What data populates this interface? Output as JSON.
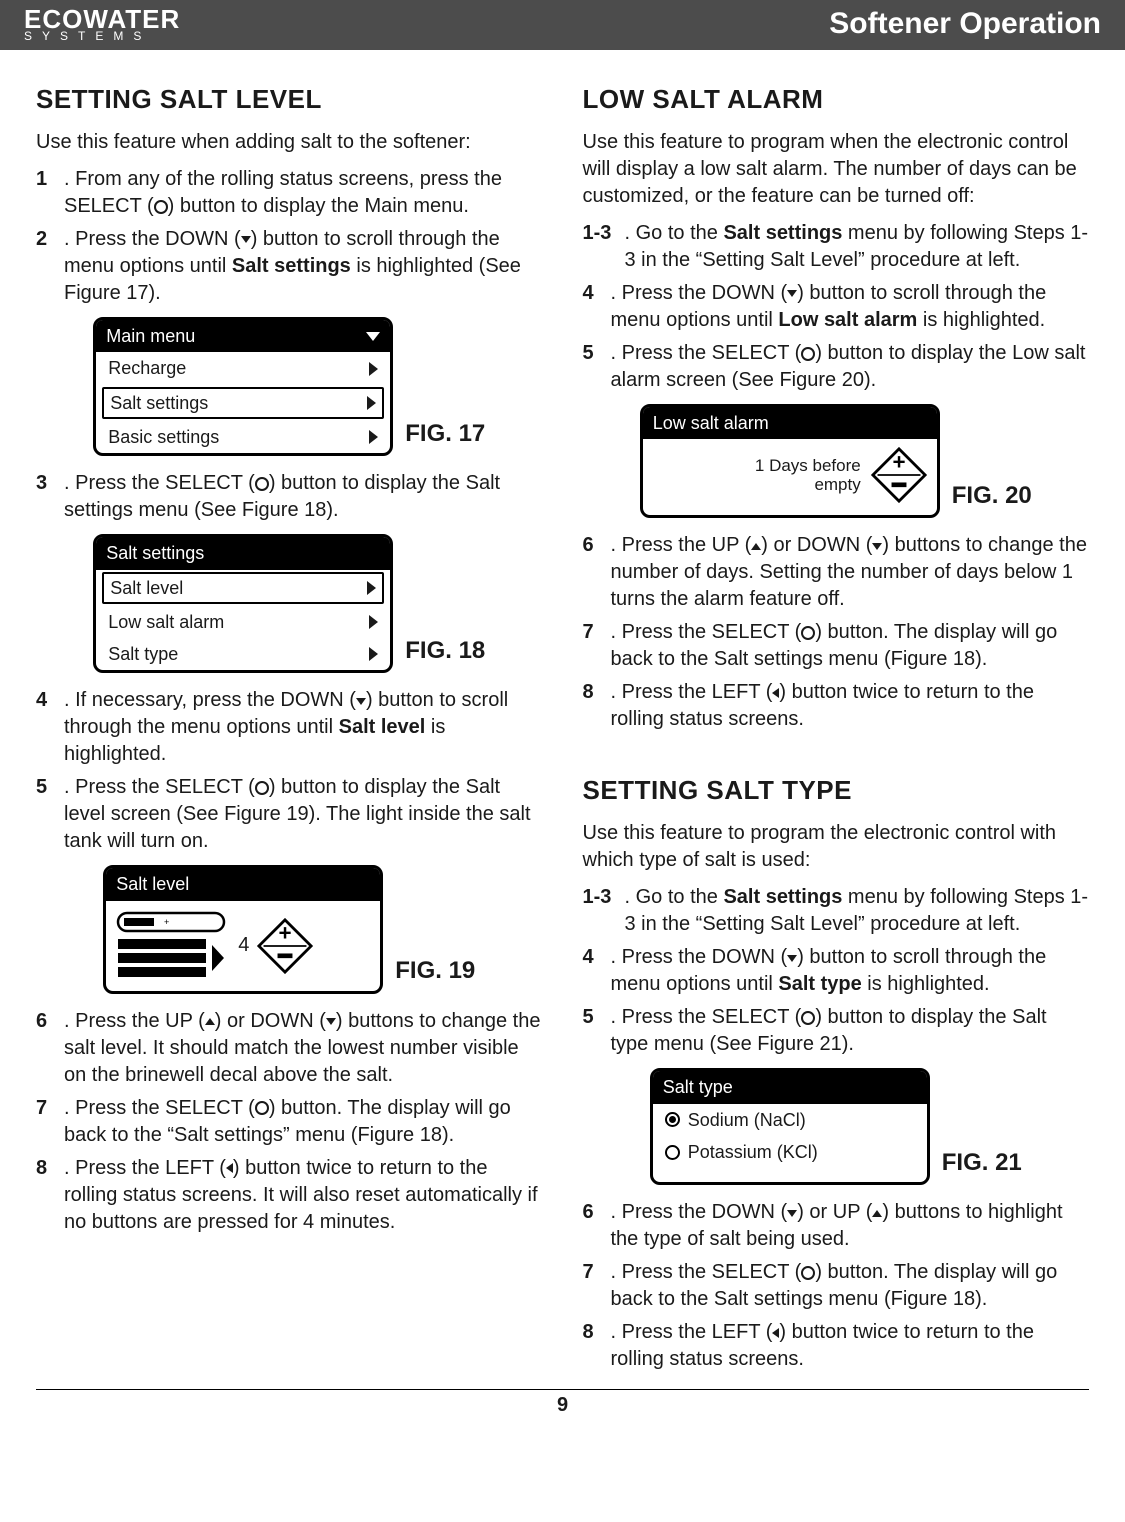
{
  "header": {
    "brand_top": "ECOWATER",
    "brand_bottom": "SYSTEMS",
    "title": "Softener Operation"
  },
  "page_number": "9",
  "left": {
    "h": "SETTING SALT LEVEL",
    "intro": "Use this feature when adding salt to the softener:",
    "s1n": "1",
    "s1a": ". From any of the rolling status screens, press the SELECT (",
    "s1b": ") button to display the Main menu.",
    "s2n": "2",
    "s2a": ". Press the DOWN (",
    "s2b": ") button to scroll through the menu options until ",
    "s2bold": "Salt settings",
    "s2c": " is highlighted (See Figure 17).",
    "fig17": {
      "title": "Main menu",
      "row1": "Recharge",
      "row2": "Salt settings",
      "row3": "Basic settings",
      "label": "FIG. 17"
    },
    "s3n": "3",
    "s3a": ". Press the SELECT (",
    "s3b": ") button to display the Salt settings menu (See Figure 18).",
    "fig18": {
      "title": "Salt settings",
      "row1": "Salt level",
      "row2": "Low salt alarm",
      "row3": "Salt type",
      "label": "FIG. 18"
    },
    "s4n": "4",
    "s4a": ". If necessary, press the DOWN (",
    "s4b": ") button to scroll through the menu options until ",
    "s4bold": "Salt level",
    "s4c": " is highlighted.",
    "s5n": "5",
    "s5a": ". Press the SELECT (",
    "s5b": ") button to display the Salt level screen (See Figure 19).  The light inside the salt tank will turn on.",
    "fig19": {
      "title": "Salt level",
      "value": "4",
      "label": "FIG. 19"
    },
    "s6n": "6",
    "s6a": ". Press the UP (",
    "s6b": ") or DOWN (",
    "s6c": ") buttons to change the salt level.  It should match the lowest number visible on the brinewell decal above the salt.",
    "s7n": "7",
    "s7a": ". Press the SELECT (",
    "s7b": ") button.  The display will go back to the “Salt settings” menu (Figure 18).",
    "s8n": "8",
    "s8a": ". Press the LEFT (",
    "s8b": ") button twice to return to the rolling status screens.  It will also reset automatically if no buttons are pressed for 4 minutes."
  },
  "rightA": {
    "h": "LOW SALT ALARM",
    "intro": "Use this feature to program when the electronic control will display a low salt alarm.  The number of days can be customized, or the feature can be turned off:",
    "s13n": "1-3",
    "s13a": ". Go to the ",
    "s13bold": "Salt settings",
    "s13b": " menu by following Steps 1-3 in the “Setting Salt Level” procedure at left.",
    "s4n": "4",
    "s4a": ". Press the DOWN (",
    "s4b": ") button to scroll through the menu options until ",
    "s4bold": "Low salt alarm",
    "s4c": " is highlighted.",
    "s5n": "5",
    "s5a": ". Press the SELECT (",
    "s5b": ") button to display the Low salt alarm screen (See Figure 20).",
    "fig20": {
      "title": "Low salt alarm",
      "line1": "1 Days before",
      "line2": "empty",
      "label": "FIG. 20"
    },
    "s6n": "6",
    "s6a": ". Press the UP (",
    "s6b": ") or DOWN (",
    "s6c": ") buttons to change the number of days.  Setting the number of days below 1 turns the alarm feature off.",
    "s7n": "7",
    "s7a": ". Press the SELECT (",
    "s7b": ") button.  The display will go back to the Salt settings menu (Figure 18).",
    "s8n": "8",
    "s8a": ". Press the LEFT (",
    "s8b": ") button twice to return to the rolling status screens."
  },
  "rightB": {
    "h": "SETTING SALT TYPE",
    "intro": "Use this feature to program the electronic control with which type of salt is used:",
    "s13n": "1-3",
    "s13a": ". Go to the ",
    "s13bold": "Salt settings",
    "s13b": " menu by following Steps 1-3 in the “Setting Salt Level” procedure at left.",
    "s4n": "4",
    "s4a": ". Press the DOWN (",
    "s4b": ") button to scroll through the menu options until ",
    "s4bold": "Salt type",
    "s4c": " is highlighted.",
    "s5n": "5",
    "s5a": ". Press the SELECT (",
    "s5b": ") button to display the Salt type menu (See Figure 21).",
    "fig21": {
      "title": "Salt type",
      "opt1": "Sodium (NaCl)",
      "opt2": "Potassium (KCl)",
      "label": "FIG. 21"
    },
    "s6n": "6",
    "s6a": ". Press the DOWN (",
    "s6b": ") or UP (",
    "s6c": ") buttons to highlight the type of salt being used.",
    "s7n": "7",
    "s7a": ". Press the SELECT (",
    "s7b": ") button.  The display will go back to the Salt settings menu (Figure 18).",
    "s8n": "8",
    "s8a": ". Press the LEFT (",
    "s8b": ") button twice to return to the rolling status screens."
  }
}
